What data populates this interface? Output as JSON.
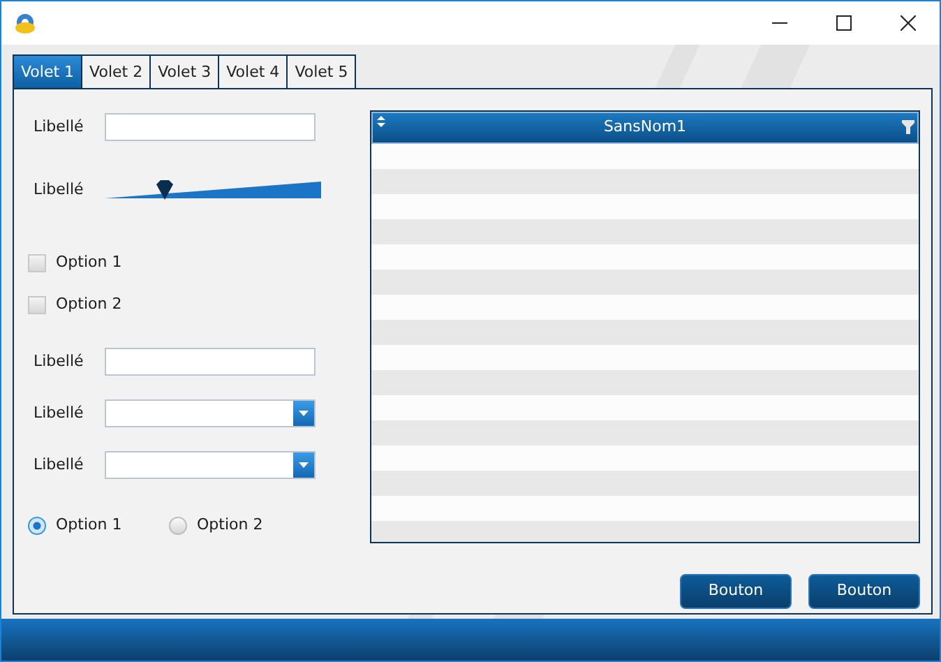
{
  "tabs": [
    {
      "label": "Volet 1",
      "selected": true
    },
    {
      "label": "Volet 2",
      "selected": false
    },
    {
      "label": "Volet 3",
      "selected": false
    },
    {
      "label": "Volet 4",
      "selected": false
    },
    {
      "label": "Volet 5",
      "selected": false
    }
  ],
  "form": [
    {
      "kind": "text",
      "label": "Libellé"
    },
    {
      "kind": "slider",
      "label": "Libellé",
      "level": 0.28
    },
    {
      "kind": "checkbox",
      "label": "Option 1",
      "checked": false
    },
    {
      "kind": "checkbox",
      "label": "Option 2",
      "checked": false
    },
    {
      "kind": "text",
      "label": "Libellé"
    },
    {
      "kind": "combo",
      "label": "Libellé"
    },
    {
      "kind": "combo",
      "label": "Libellé"
    },
    {
      "kind": "radio",
      "options": [
        {
          "label": "Option 1",
          "selected": true
        },
        {
          "label": "Option 2",
          "selected": false
        }
      ]
    }
  ],
  "table": {
    "columns": [
      "SansNom1"
    ]
  },
  "buttons": [
    "Bouton",
    "Bouton"
  ]
}
